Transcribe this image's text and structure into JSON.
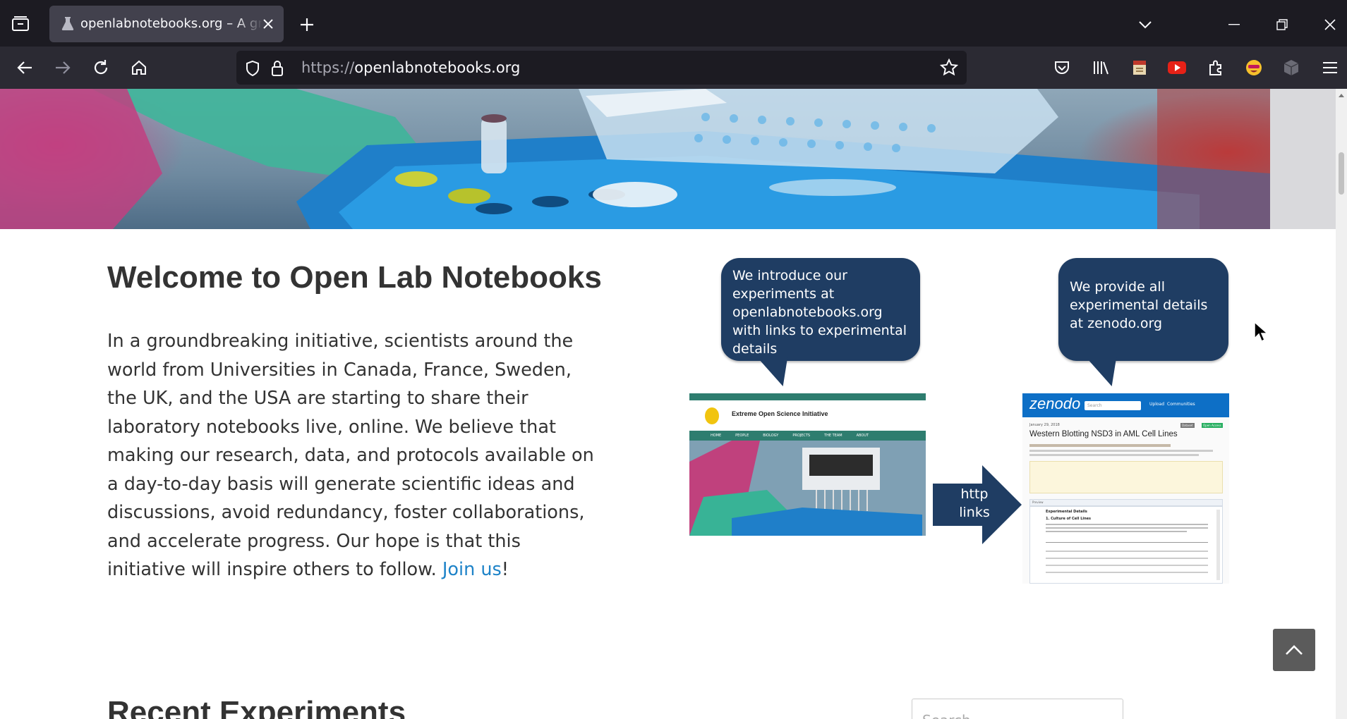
{
  "browser": {
    "tab_title": "openlabnotebooks.org – A growing community of scientists",
    "url_scheme": "https://",
    "url_host": "openlabnotebooks.org"
  },
  "page": {
    "welcome_title": "Welcome to Open Lab Notebooks",
    "welcome_text": "In a groundbreaking initiative, scientists around the world from Universities in Canada, France, Sweden, the UK, and the USA are starting to share their laboratory notebooks live, online. We believe that making our research, data, and protocols available on a day-to-day basis will generate scientific ideas and discussions, avoid redundancy, foster collaborations, and accelerate progress. Our hope is that this initiative will inspire others to follow. ",
    "join_link": "Join us",
    "join_suffix": "!",
    "recent_title": "Recent Experiments",
    "search_placeholder": "Search"
  },
  "diagram": {
    "bubble_left": "We introduce our experiments at openlabnotebooks.org with links to experimental details",
    "bubble_right": "We provide all experimental details at zenodo.org",
    "arrow_label": "http links",
    "left_shot_title": "Extreme Open Science Initiative",
    "left_shot_nav": [
      "HOME",
      "PEOPLE",
      "BIOLOGY",
      "PROJECTS",
      "THE TEAM",
      "ABOUT"
    ],
    "right_shot_logo": "zenodo",
    "right_shot_search": "Search",
    "right_shot_nav": [
      "Upload",
      "Communities"
    ],
    "right_shot_date": "January 29, 2018",
    "right_shot_title": "Western Blotting NSD3 in AML Cell Lines",
    "right_shot_badges": [
      "Dataset",
      "Open Access"
    ],
    "right_shot_section": "Experimental Details",
    "right_shot_subsection": "1. Culture of Cell Lines",
    "right_shot_preview": "Preview"
  },
  "colors": {
    "accent_link": "#1e83c8",
    "bubble": "#1f3d63",
    "chrome_dark": "#1c1b22"
  }
}
